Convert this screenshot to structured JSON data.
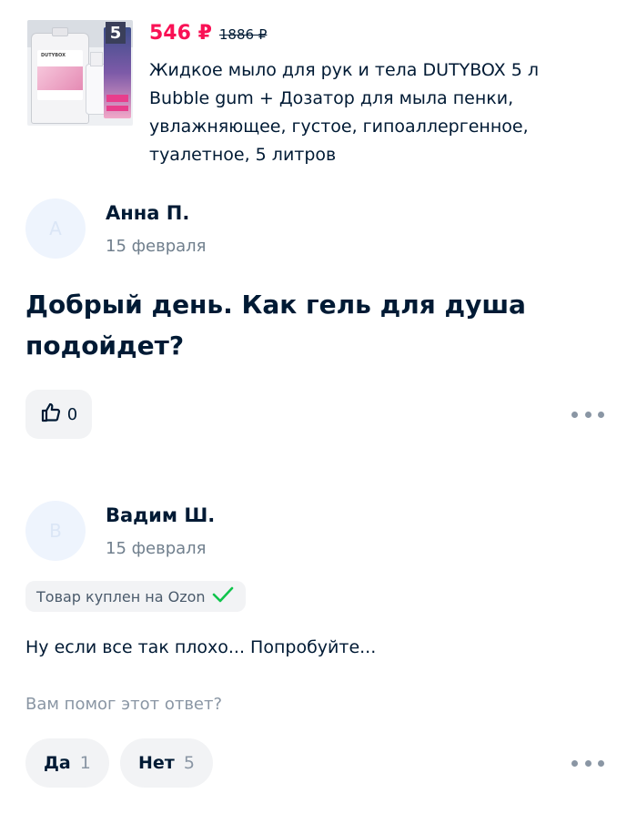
{
  "product": {
    "image_badge": "5",
    "image_brand_text": "DUTYBOX",
    "price": "546 ₽",
    "old_price": "1886 ₽",
    "title": "Жидкое мыло для рук и тела DUTYBOX 5 л Bubble gum + Дозатор для мыла пенки, увлажняющее, густое, гипоаллергенное, туалетное, 5 литров"
  },
  "question": {
    "avatar_letter": "А",
    "author": "Анна П.",
    "date": "15 февраля",
    "text": "Добрый день. Как гель для душа подойдет?",
    "likes": "0"
  },
  "answer": {
    "avatar_letter": "В",
    "author": "Вадим Ш.",
    "date": "15 февраля",
    "purchased_badge": "Товар куплен на Ozon",
    "text": "Ну если все так плохо... Попробуйте...",
    "helpful_prompt": "Вам помог этот ответ?",
    "yes_label": "Да",
    "yes_count": "1",
    "no_label": "Нет",
    "no_count": "5"
  },
  "colors": {
    "price": "#f91155",
    "text": "#001a34",
    "muted": "#707f8d",
    "check": "#10c44c",
    "button_bg": "#f2f3f5"
  }
}
